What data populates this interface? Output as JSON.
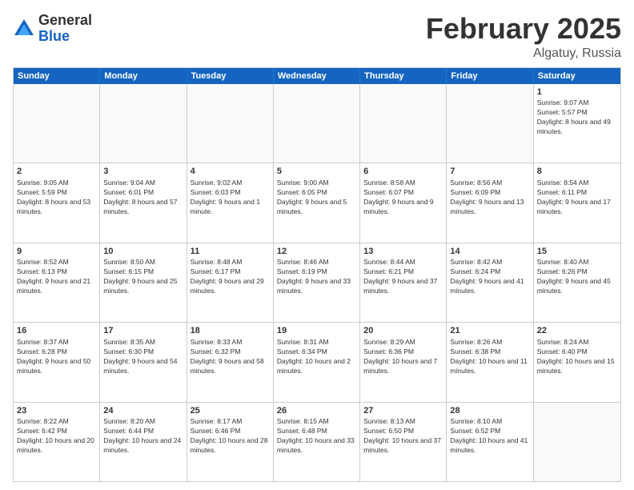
{
  "header": {
    "logo_general": "General",
    "logo_blue": "Blue",
    "month_title": "February 2025",
    "location": "Algatuy, Russia"
  },
  "days_of_week": [
    "Sunday",
    "Monday",
    "Tuesday",
    "Wednesday",
    "Thursday",
    "Friday",
    "Saturday"
  ],
  "weeks": [
    [
      {
        "day": "",
        "content": ""
      },
      {
        "day": "",
        "content": ""
      },
      {
        "day": "",
        "content": ""
      },
      {
        "day": "",
        "content": ""
      },
      {
        "day": "",
        "content": ""
      },
      {
        "day": "",
        "content": ""
      },
      {
        "day": "1",
        "content": "Sunrise: 9:07 AM\nSunset: 5:57 PM\nDaylight: 8 hours and 49 minutes."
      }
    ],
    [
      {
        "day": "2",
        "content": "Sunrise: 9:05 AM\nSunset: 5:59 PM\nDaylight: 8 hours and 53 minutes."
      },
      {
        "day": "3",
        "content": "Sunrise: 9:04 AM\nSunset: 6:01 PM\nDaylight: 8 hours and 57 minutes."
      },
      {
        "day": "4",
        "content": "Sunrise: 9:02 AM\nSunset: 6:03 PM\nDaylight: 9 hours and 1 minute."
      },
      {
        "day": "5",
        "content": "Sunrise: 9:00 AM\nSunset: 6:05 PM\nDaylight: 9 hours and 5 minutes."
      },
      {
        "day": "6",
        "content": "Sunrise: 8:58 AM\nSunset: 6:07 PM\nDaylight: 9 hours and 9 minutes."
      },
      {
        "day": "7",
        "content": "Sunrise: 8:56 AM\nSunset: 6:09 PM\nDaylight: 9 hours and 13 minutes."
      },
      {
        "day": "8",
        "content": "Sunrise: 8:54 AM\nSunset: 6:11 PM\nDaylight: 9 hours and 17 minutes."
      }
    ],
    [
      {
        "day": "9",
        "content": "Sunrise: 8:52 AM\nSunset: 6:13 PM\nDaylight: 9 hours and 21 minutes."
      },
      {
        "day": "10",
        "content": "Sunrise: 8:50 AM\nSunset: 6:15 PM\nDaylight: 9 hours and 25 minutes."
      },
      {
        "day": "11",
        "content": "Sunrise: 8:48 AM\nSunset: 6:17 PM\nDaylight: 9 hours and 29 minutes."
      },
      {
        "day": "12",
        "content": "Sunrise: 8:46 AM\nSunset: 6:19 PM\nDaylight: 9 hours and 33 minutes."
      },
      {
        "day": "13",
        "content": "Sunrise: 8:44 AM\nSunset: 6:21 PM\nDaylight: 9 hours and 37 minutes."
      },
      {
        "day": "14",
        "content": "Sunrise: 8:42 AM\nSunset: 6:24 PM\nDaylight: 9 hours and 41 minutes."
      },
      {
        "day": "15",
        "content": "Sunrise: 8:40 AM\nSunset: 6:26 PM\nDaylight: 9 hours and 45 minutes."
      }
    ],
    [
      {
        "day": "16",
        "content": "Sunrise: 8:37 AM\nSunset: 6:28 PM\nDaylight: 9 hours and 50 minutes."
      },
      {
        "day": "17",
        "content": "Sunrise: 8:35 AM\nSunset: 6:30 PM\nDaylight: 9 hours and 54 minutes."
      },
      {
        "day": "18",
        "content": "Sunrise: 8:33 AM\nSunset: 6:32 PM\nDaylight: 9 hours and 58 minutes."
      },
      {
        "day": "19",
        "content": "Sunrise: 8:31 AM\nSunset: 6:34 PM\nDaylight: 10 hours and 2 minutes."
      },
      {
        "day": "20",
        "content": "Sunrise: 8:29 AM\nSunset: 6:36 PM\nDaylight: 10 hours and 7 minutes."
      },
      {
        "day": "21",
        "content": "Sunrise: 8:26 AM\nSunset: 6:38 PM\nDaylight: 10 hours and 11 minutes."
      },
      {
        "day": "22",
        "content": "Sunrise: 8:24 AM\nSunset: 6:40 PM\nDaylight: 10 hours and 15 minutes."
      }
    ],
    [
      {
        "day": "23",
        "content": "Sunrise: 8:22 AM\nSunset: 6:42 PM\nDaylight: 10 hours and 20 minutes."
      },
      {
        "day": "24",
        "content": "Sunrise: 8:20 AM\nSunset: 6:44 PM\nDaylight: 10 hours and 24 minutes."
      },
      {
        "day": "25",
        "content": "Sunrise: 8:17 AM\nSunset: 6:46 PM\nDaylight: 10 hours and 28 minutes."
      },
      {
        "day": "26",
        "content": "Sunrise: 8:15 AM\nSunset: 6:48 PM\nDaylight: 10 hours and 33 minutes."
      },
      {
        "day": "27",
        "content": "Sunrise: 8:13 AM\nSunset: 6:50 PM\nDaylight: 10 hours and 37 minutes."
      },
      {
        "day": "28",
        "content": "Sunrise: 8:10 AM\nSunset: 6:52 PM\nDaylight: 10 hours and 41 minutes."
      },
      {
        "day": "",
        "content": ""
      }
    ]
  ]
}
